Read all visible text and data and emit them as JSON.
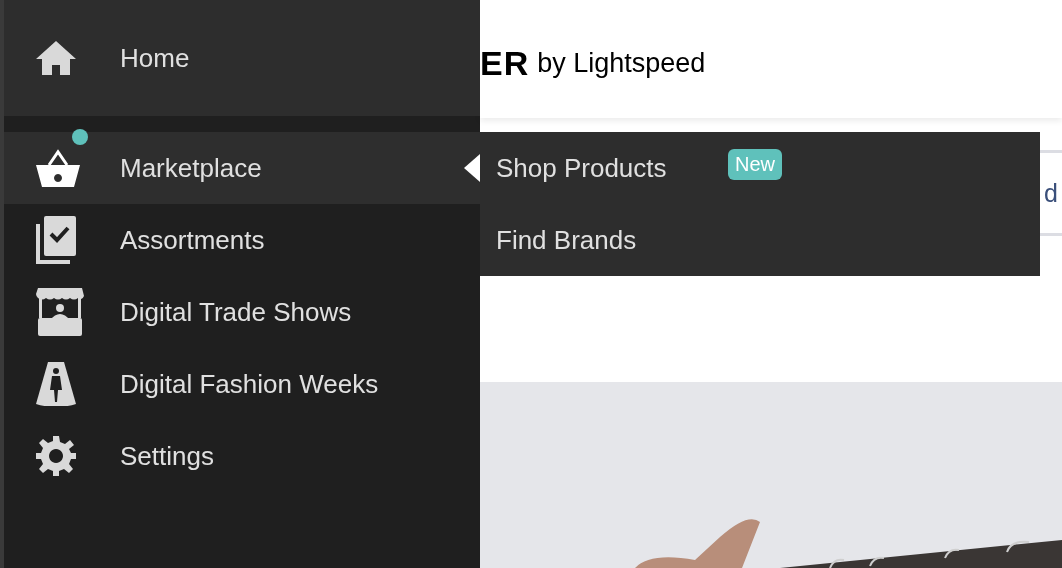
{
  "sidebar": {
    "items": [
      {
        "label": "Home",
        "kind": "home",
        "selected": false,
        "notification": false
      },
      {
        "label": "Marketplace",
        "kind": "basket",
        "selected": true,
        "notification": true
      },
      {
        "label": "Assortments",
        "kind": "assortment",
        "selected": false,
        "notification": false
      },
      {
        "label": "Digital Trade Shows",
        "kind": "booth",
        "selected": false,
        "notification": false
      },
      {
        "label": "Digital Fashion Weeks",
        "kind": "runway",
        "selected": false,
        "notification": false
      },
      {
        "label": "Settings",
        "kind": "gear",
        "selected": false,
        "notification": false
      }
    ]
  },
  "submenu": {
    "items": [
      {
        "label": "Shop Products",
        "badge": "New"
      },
      {
        "label": "Find Brands"
      }
    ]
  },
  "header": {
    "logo_mark": "ER",
    "logo_text": "by Lightspeed"
  },
  "nav_bar": {
    "text": "d"
  }
}
